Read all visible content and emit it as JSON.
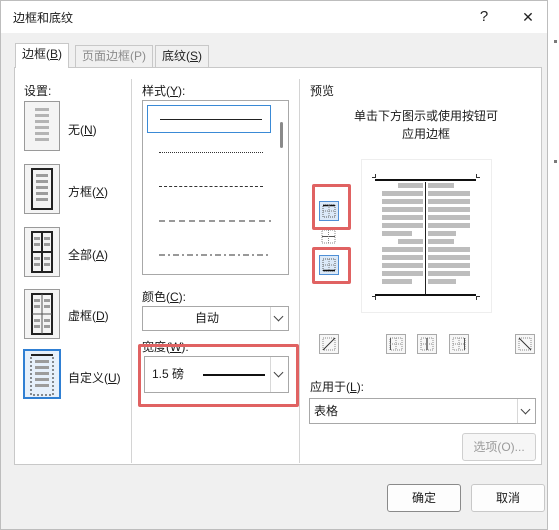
{
  "window": {
    "title": "边框和底纹",
    "help_label": "?",
    "close_label": "✕"
  },
  "tabs": [
    {
      "label": "边框(",
      "key": "B",
      "end": ")"
    },
    {
      "label": "页面边框(P)"
    },
    {
      "label": "底纹(",
      "key": "S",
      "end": ")"
    }
  ],
  "settings": {
    "heading": "设置:",
    "items": [
      {
        "label": "无(",
        "key": "N",
        "end": ")"
      },
      {
        "label": "方框(",
        "key": "X",
        "end": ")"
      },
      {
        "label": "全部(",
        "key": "A",
        "end": ")"
      },
      {
        "label": "虚框(",
        "key": "D",
        "end": ")"
      },
      {
        "label": "自定义(",
        "key": "U",
        "end": ")"
      }
    ],
    "selected": "自定义"
  },
  "style": {
    "heading": "样式(",
    "key": "Y",
    "end": "):",
    "items": [
      "solid",
      "dotted",
      "dashed",
      "dash-long",
      "dash-dot"
    ],
    "selected": "solid"
  },
  "color": {
    "heading": "颜色(",
    "key": "C",
    "end": "):",
    "value": "自动"
  },
  "width": {
    "heading": "宽度(",
    "key": "W",
    "end": "):",
    "value": "1.5 磅"
  },
  "preview": {
    "heading": "预览",
    "instruction_line1": "单击下方图示或使用按钮可",
    "instruction_line2": "应用边框"
  },
  "apply_to": {
    "heading": "应用于(",
    "key": "L",
    "end": "):",
    "value": "表格"
  },
  "buttons": {
    "options": "选项(O)...",
    "ok": "确定",
    "cancel": "取消"
  },
  "colors": {
    "highlight": "#e06262",
    "accent": "#2f7fd3"
  }
}
